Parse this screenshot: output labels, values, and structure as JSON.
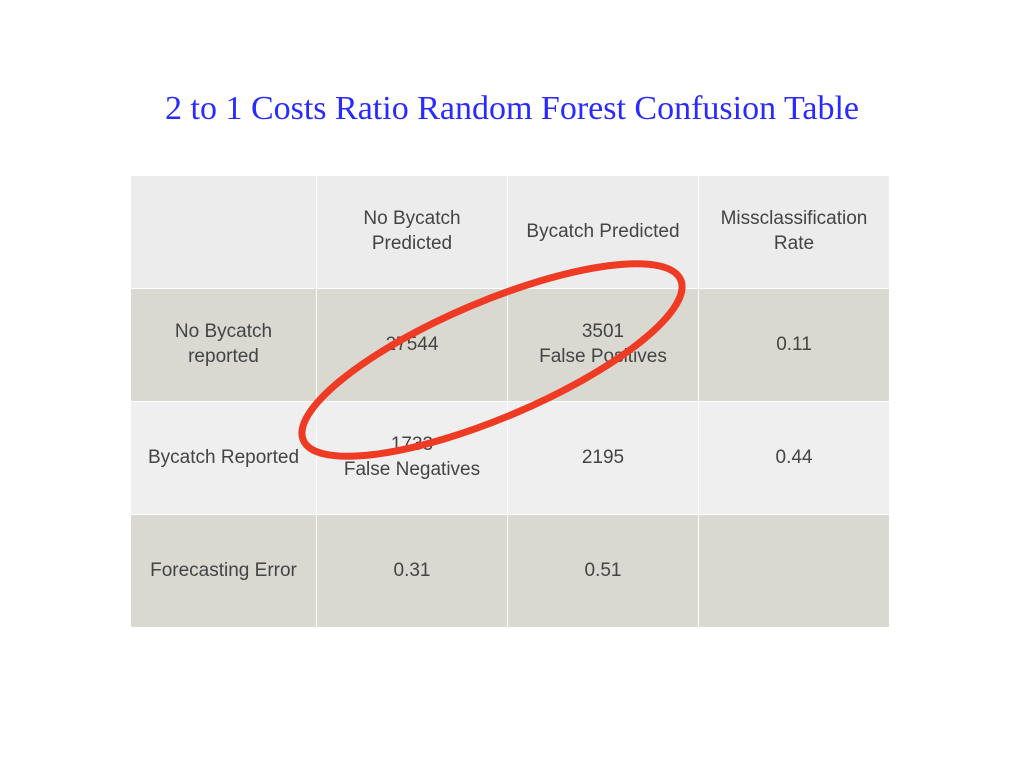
{
  "title": "2 to 1 Costs Ratio Random Forest Confusion Table",
  "headers": {
    "c0": "",
    "c1": "No Bycatch Predicted",
    "c2": "Bycatch Predicted",
    "c3": "Missclassification Rate"
  },
  "rows": [
    {
      "label": "No Bycatch reported",
      "c1": "27544",
      "c2": "3501\nFalse Positives",
      "c3": "0.11"
    },
    {
      "label": "Bycatch Reported",
      "c1": "1733\nFalse Negatives",
      "c2": "2195",
      "c3": "0.44"
    },
    {
      "label": "Forecasting Error",
      "c1": "0.31",
      "c2": "0.51",
      "c3": ""
    }
  ],
  "annotation": {
    "name": "red-ellipse-highlight",
    "stroke": "#ef3a24"
  }
}
